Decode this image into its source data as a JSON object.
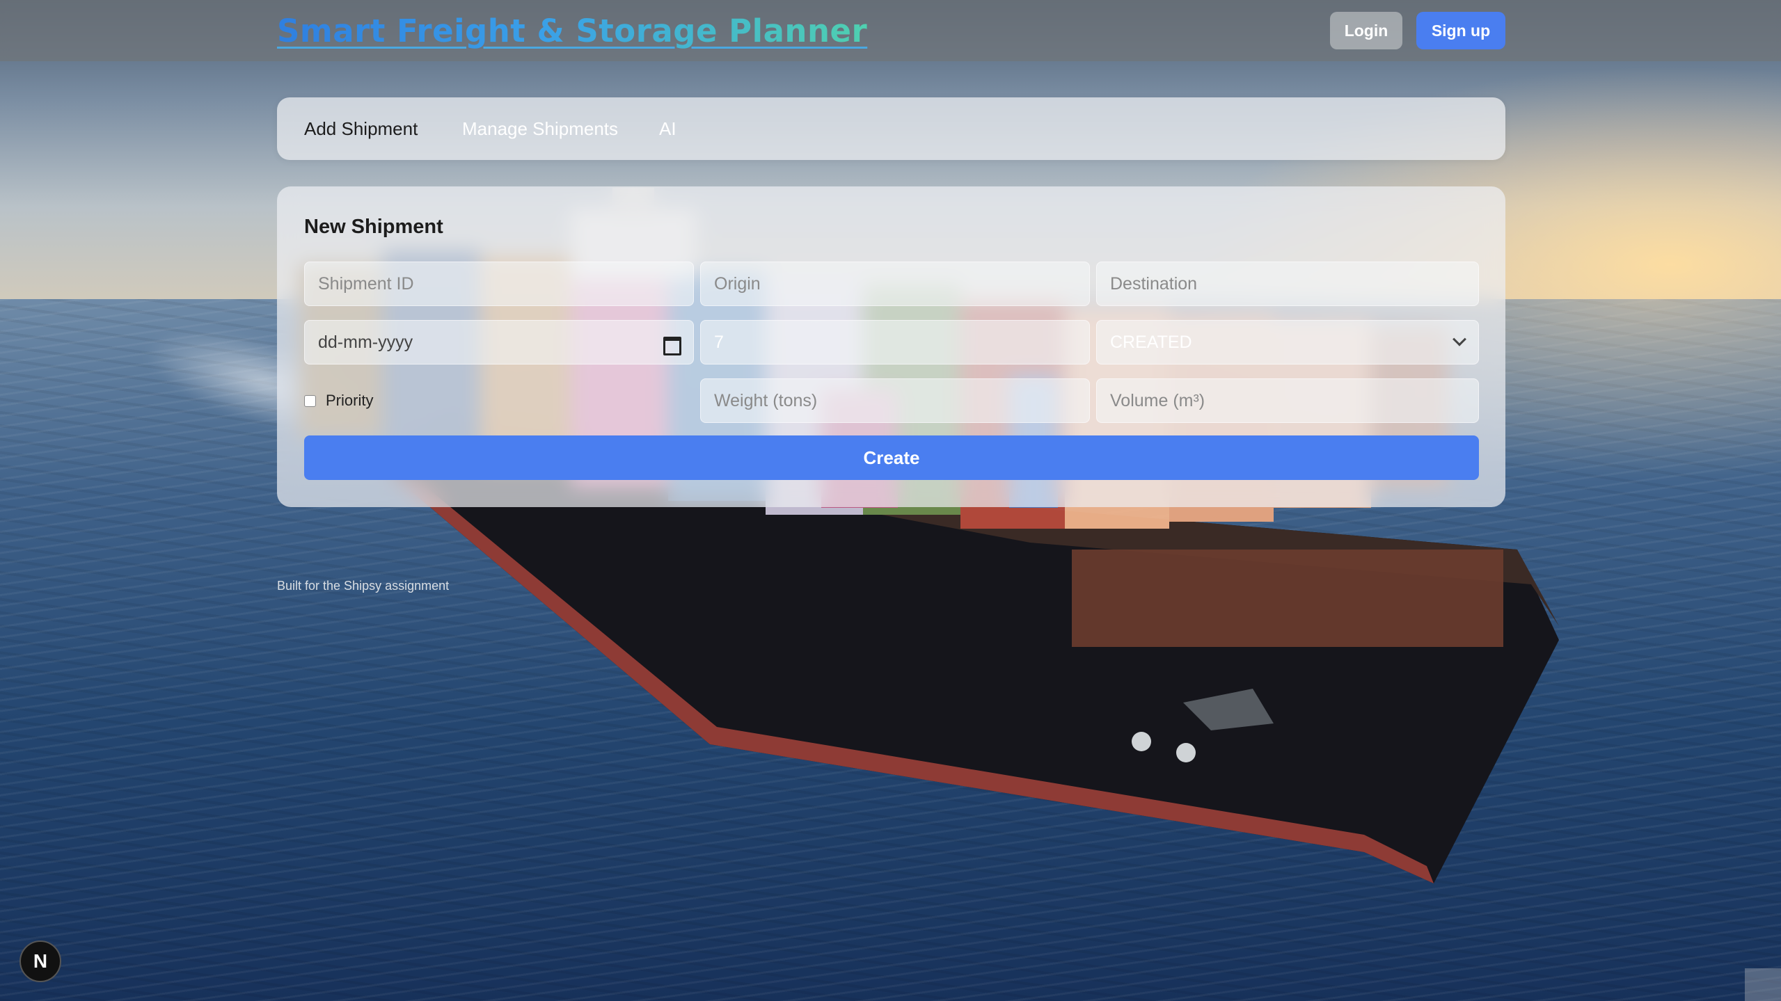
{
  "header": {
    "brand": "Smart Freight & Storage Planner",
    "login_label": "Login",
    "signup_label": "Sign up"
  },
  "tabs": [
    {
      "label": "Add Shipment",
      "active": true
    },
    {
      "label": "Manage Shipments",
      "active": false
    },
    {
      "label": "AI",
      "active": false
    }
  ],
  "form": {
    "title": "New Shipment",
    "shipment_id": {
      "placeholder": "Shipment ID",
      "value": ""
    },
    "origin": {
      "placeholder": "Origin",
      "value": ""
    },
    "destination": {
      "placeholder": "Destination",
      "value": ""
    },
    "date": {
      "placeholder": "dd-mm-yyyy"
    },
    "days": {
      "value": "7"
    },
    "status": {
      "selected": "CREATED"
    },
    "priority": {
      "label": "Priority",
      "checked": false
    },
    "weight": {
      "placeholder": "Weight (tons)",
      "value": ""
    },
    "volume": {
      "placeholder": "Volume (m³)",
      "value": ""
    },
    "create_label": "Create"
  },
  "footer": {
    "note": "Built for the Shipsy assignment"
  },
  "badge": {
    "letter": "N"
  },
  "colors": {
    "accent": "#4a7ef0",
    "brand_gradient_start": "#2f7fe0",
    "brand_gradient_end": "#4fd0b0"
  },
  "icons": {
    "date": "calendar-icon",
    "status": "chevron-down-icon"
  }
}
